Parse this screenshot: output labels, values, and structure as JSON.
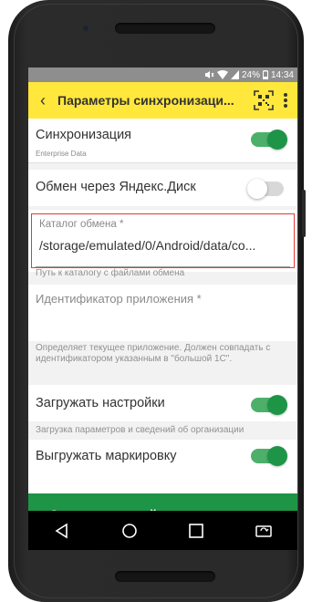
{
  "status": {
    "icons": [
      "mute-icon",
      "wifi-icon",
      "signal-icon",
      "battery-icon"
    ],
    "battery": "24%",
    "time": "14:34"
  },
  "appbar": {
    "title": "Параметры синхронизаци...",
    "background": "#ffe73c"
  },
  "settings": {
    "sync": {
      "label": "Синхронизация",
      "sub": "Enterprise Data",
      "on": true
    },
    "yadisk": {
      "label": "Обмен через Яндекс.Диск",
      "on": false
    },
    "catalog": {
      "label": "Каталог обмена *",
      "value": "/storage/emulated/0/Android/data/co...",
      "hint": "Путь к каталогу с файлами обмена"
    },
    "app_id": {
      "label": "Идентификатор приложения *",
      "value": "",
      "hint": "Определяет текущее приложение. Должен совпадать с идентификатором указанным в \"большой 1С\"."
    },
    "load_settings": {
      "label": "Загружать настройки",
      "hint": "Загрузка параметров и сведений об организации",
      "on": true
    },
    "unload_marking": {
      "label": "Выгружать маркировку",
      "on": true
    }
  },
  "primary_button": {
    "label": "Создать настройку синхронизации",
    "color": "#1e9447"
  },
  "colors": {
    "toggle_on": "#1e9447",
    "highlight_border": "#e53935"
  }
}
